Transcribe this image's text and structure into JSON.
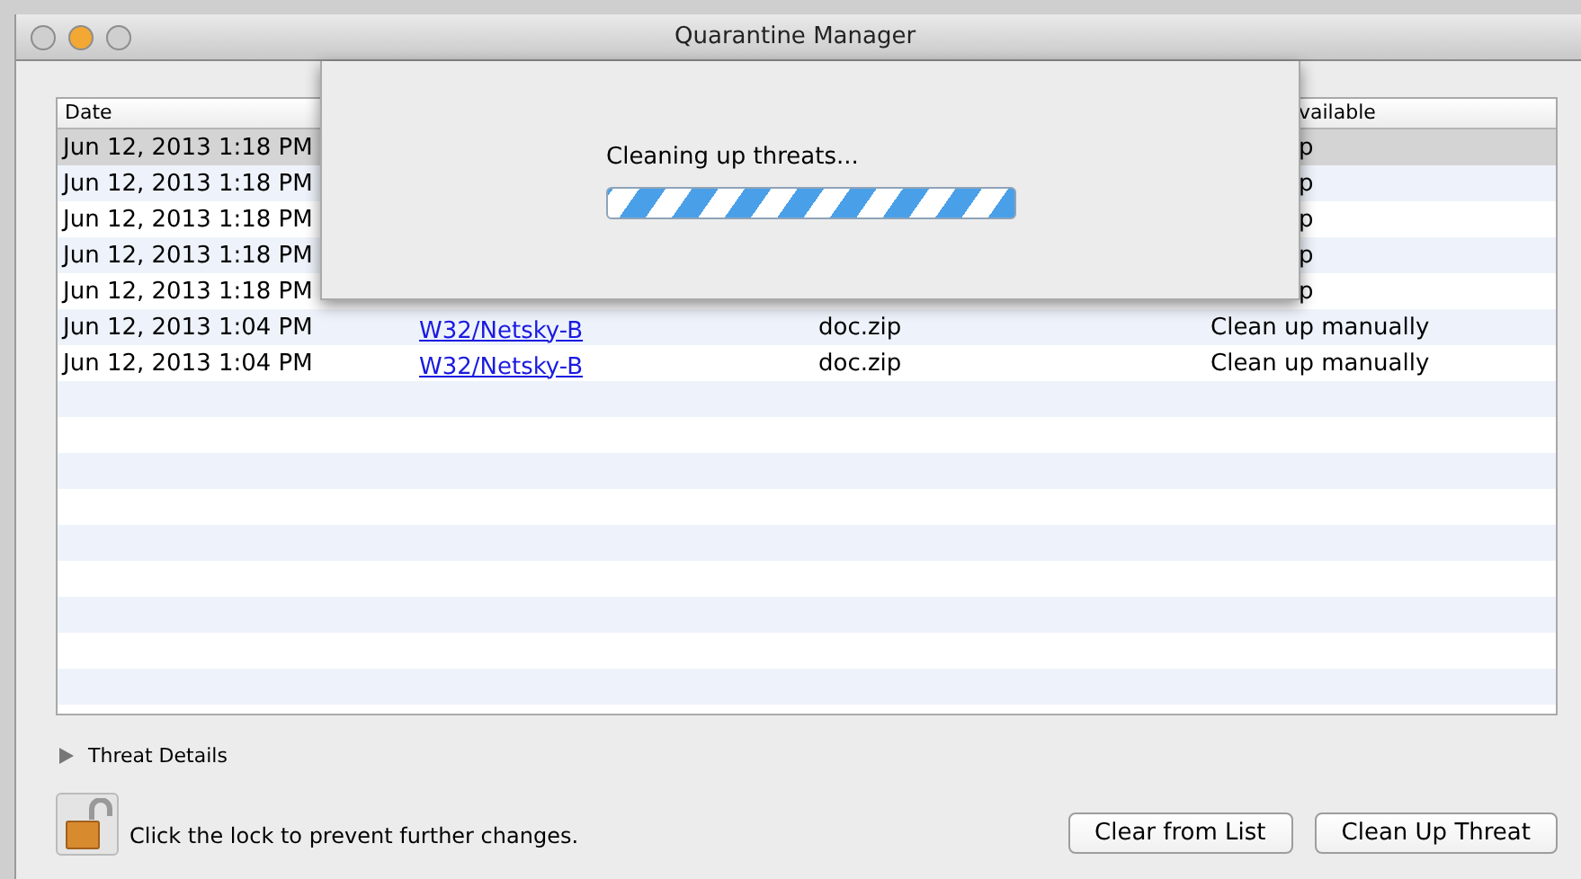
{
  "window": {
    "title": "Quarantine Manager"
  },
  "table": {
    "header": {
      "column_1": "Date",
      "column_4": "vailable"
    },
    "rows": [
      {
        "date": "Jun 12, 2013 1:18 PM",
        "action": "p",
        "selected": true
      },
      {
        "date": "Jun 12, 2013 1:18 PM",
        "action": "p",
        "selected": false
      },
      {
        "date": "Jun 12, 2013 1:18 PM",
        "action": "p",
        "selected": false
      },
      {
        "date": "Jun 12, 2013 1:18 PM",
        "action": "p",
        "selected": false
      },
      {
        "date": "Jun 12, 2013 1:18 PM",
        "action": "p",
        "selected": false
      },
      {
        "date": "Jun 12, 2013 1:04 PM",
        "threat": "W32/Netsky-B",
        "filename": "doc.zip",
        "action": "Clean up manually",
        "selected": false
      },
      {
        "date": "Jun 12, 2013 1:04 PM",
        "threat": "W32/Netsky-B",
        "filename": "doc.zip",
        "action": "Clean up manually",
        "selected": false
      }
    ]
  },
  "sheet": {
    "message": "Cleaning up threats...",
    "indeterminate": true
  },
  "details": {
    "label": "Threat Details",
    "expanded": false
  },
  "lock": {
    "text": "Click the lock to prevent further changes.",
    "locked": false
  },
  "buttons": [
    "Clear from List",
    "Clean Up Threat"
  ]
}
